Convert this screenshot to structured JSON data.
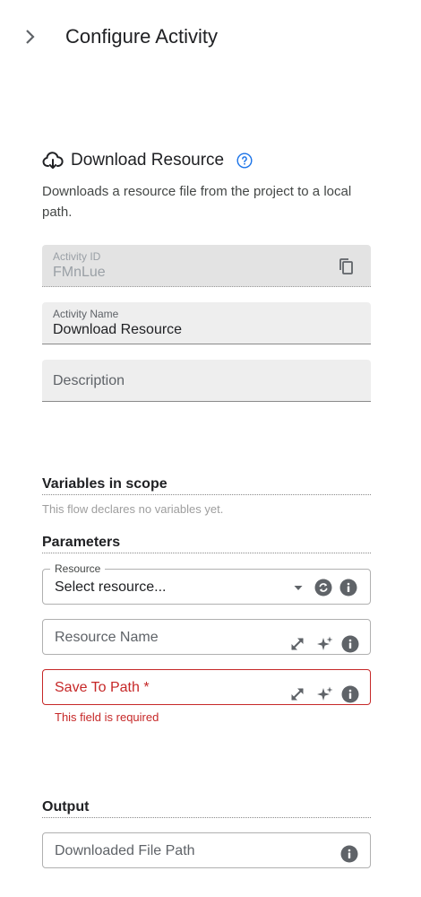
{
  "header": {
    "title": "Configure Activity"
  },
  "activity": {
    "title": "Download Resource",
    "description": "Downloads a resource file from the project to a local path."
  },
  "fields": {
    "activity_id": {
      "label": "Activity ID",
      "value": "FMnLue"
    },
    "activity_name": {
      "label": "Activity Name",
      "value": "Download Resource"
    },
    "description": {
      "placeholder": "Description"
    }
  },
  "variables": {
    "heading": "Variables in scope",
    "empty_text": "This flow declares no variables yet."
  },
  "parameters": {
    "heading": "Parameters",
    "resource": {
      "label": "Resource",
      "value": "Select resource..."
    },
    "resource_name": {
      "placeholder": "Resource Name"
    },
    "save_to_path": {
      "placeholder": "Save To Path *",
      "error": "This field is required"
    }
  },
  "output": {
    "heading": "Output",
    "downloaded_file_path": {
      "placeholder": "Downloaded File Path"
    }
  },
  "colors": {
    "accent": "#1a73e8",
    "error": "#c62828",
    "icon": "#5f6368"
  }
}
